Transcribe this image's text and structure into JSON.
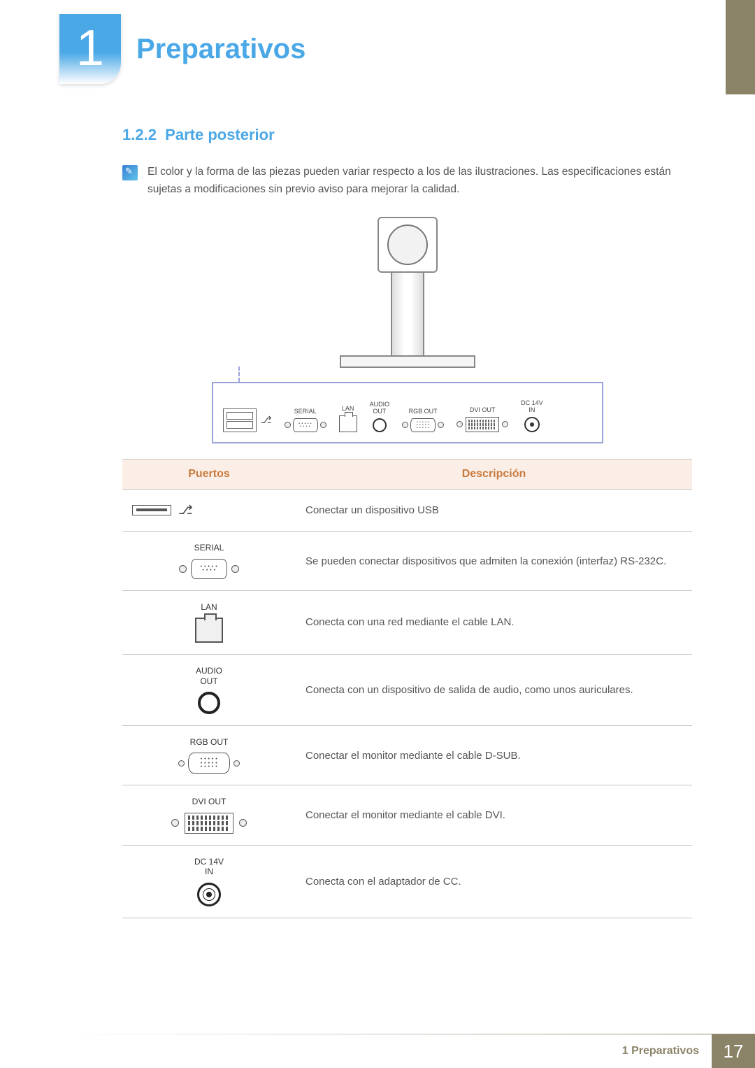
{
  "chapter": {
    "number": "1",
    "title": "Preparativos"
  },
  "section": {
    "number": "1.2.2",
    "title": "Parte posterior"
  },
  "note": "El color y la forma de las piezas pueden variar respecto a los de las ilustraciones. Las especificaciones están sujetas a modificaciones sin previo aviso para mejorar la calidad.",
  "diagram_labels": {
    "serial": "SERIAL",
    "lan": "LAN",
    "audio_out": "AUDIO\nOUT",
    "rgb_out": "RGB OUT",
    "dvi_out": "DVI OUT",
    "dc": "DC 14V\nIN"
  },
  "table": {
    "headers": {
      "ports": "Puertos",
      "desc": "Descripción"
    },
    "rows": [
      {
        "label": "",
        "desc": "Conectar un dispositivo USB"
      },
      {
        "label": "SERIAL",
        "desc": "Se pueden conectar dispositivos que admiten la conexión (interfaz) RS-232C."
      },
      {
        "label": "LAN",
        "desc": "Conecta con una red mediante el cable LAN."
      },
      {
        "label": "AUDIO\nOUT",
        "desc": "Conecta con un dispositivo de salida de audio, como unos auriculares."
      },
      {
        "label": "RGB OUT",
        "desc": "Conectar el monitor mediante el cable D-SUB."
      },
      {
        "label": "DVI OUT",
        "desc": "Conectar el monitor mediante el cable DVI."
      },
      {
        "label": "DC 14V\nIN",
        "desc": "Conecta con el adaptador de CC."
      }
    ]
  },
  "footer": {
    "text": "1 Preparativos",
    "page": "17"
  }
}
